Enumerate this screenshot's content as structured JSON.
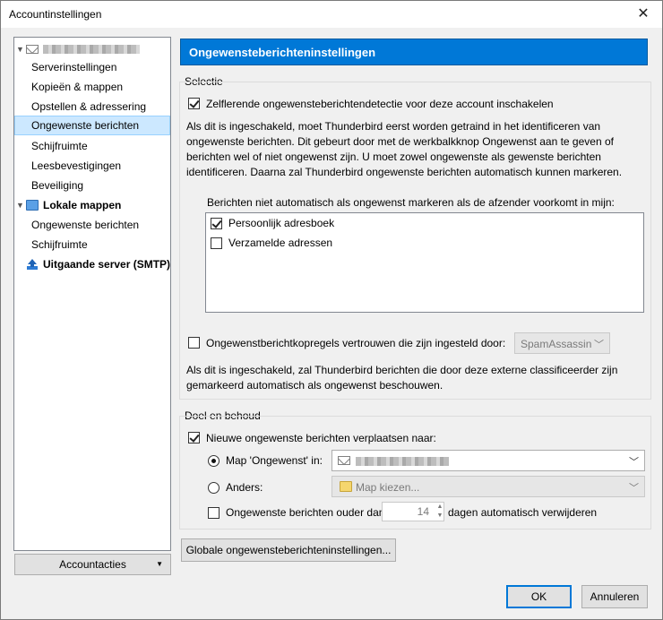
{
  "window": {
    "title": "Accountinstellingen"
  },
  "tree": {
    "account_name": "",
    "items": [
      "Serverinstellingen",
      "Kopieën & mappen",
      "Opstellen & adressering",
      "Ongewenste berichten",
      "Schijfruimte",
      "Leesbevestigingen",
      "Beveiliging"
    ],
    "local_folders": "Lokale mappen",
    "local_items": [
      "Ongewenste berichten",
      "Schijfruimte"
    ],
    "outgoing": "Uitgaande server (SMTP)"
  },
  "account_actions": "Accountacties",
  "header": "Ongewensteberichteninstellingen",
  "selectie": {
    "label": "Selectie",
    "adaptive_cb": "Zelflerende ongewensteberichtendetectie voor deze account inschakelen",
    "adaptive_help": "Als dit is ingeschakeld, moet Thunderbird eerst worden getraind in het identificeren van ongewenste berichten. Dit gebeurt door met de werkbalkknop Ongewenst aan te geven of berichten wel of niet ongewenst zijn. U moet zowel ongewenste als gewenste berichten identificeren. Daarna zal Thunderbird ongewenste berichten automatisch kunnen markeren.",
    "whitelist_label": "Berichten niet automatisch als ongewenst markeren als de afzender voorkomt in mijn:",
    "whitelist": [
      "Persoonlijk adresboek",
      "Verzamelde adressen"
    ],
    "trust_cb": "Ongewenstberichtkopregels vertrouwen die zijn ingesteld door:",
    "trust_select": "SpamAssassin",
    "trust_help": "Als dit is ingeschakeld, zal Thunderbird berichten die door deze externe classificeerder zijn gemarkeerd automatisch als ongewenst beschouwen."
  },
  "doel": {
    "label": "Doel en behoud",
    "move_cb": "Nieuwe ongewenste berichten verplaatsen naar:",
    "radio_junk": "Map 'Ongewenst' in:",
    "radio_other": "Anders:",
    "other_select": "Map kiezen...",
    "purge_cb": "Ongewenste berichten ouder dan",
    "purge_days": "14",
    "purge_suffix": "dagen automatisch verwijderen"
  },
  "global_btn": "Globale ongewensteberichteninstellingen...",
  "ok": "OK",
  "cancel": "Annuleren"
}
